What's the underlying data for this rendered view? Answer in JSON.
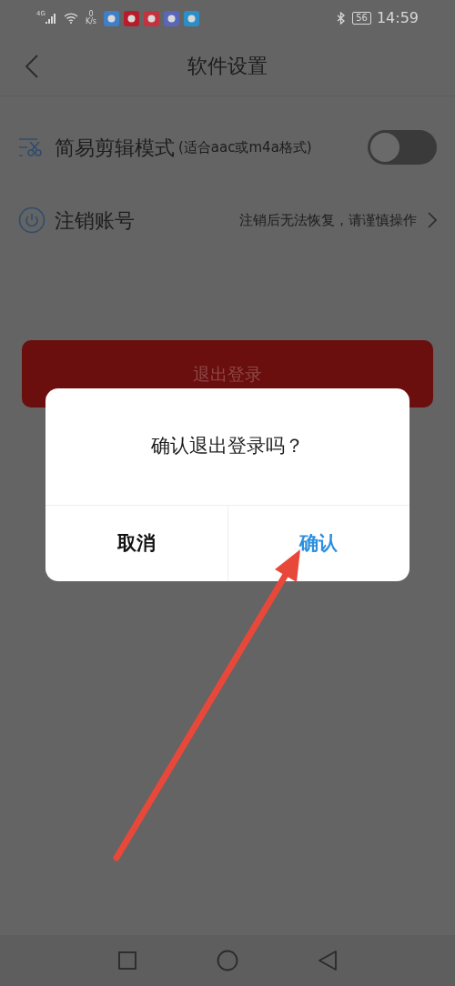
{
  "status_bar": {
    "network": "4G",
    "speed": "0",
    "speed_unit": "K/s",
    "battery": "56",
    "time": "14:59"
  },
  "header": {
    "title": "软件设置"
  },
  "settings": [
    {
      "kind": "toggle",
      "label": "简易剪辑模式",
      "note": "(适合aac或m4a格式)",
      "on": false
    },
    {
      "kind": "link",
      "label": "注销账号",
      "note": "注销后无法恢复，请谨慎操作"
    }
  ],
  "logout_button": "退出登录",
  "dialog": {
    "message": "确认退出登录吗？",
    "buttons": [
      {
        "label": "取消",
        "kind": "cancel"
      },
      {
        "label": "确认",
        "kind": "confirm"
      }
    ]
  }
}
